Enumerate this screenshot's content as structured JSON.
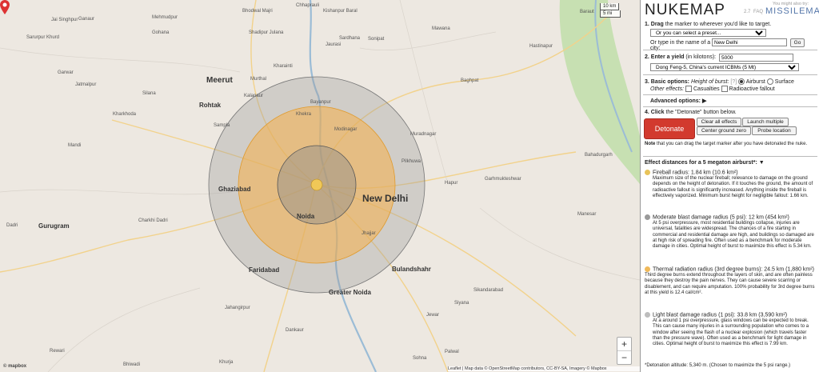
{
  "app": {
    "title": "NUKEMAP",
    "version": "2.7",
    "faq": "FAQ",
    "also_label": "You might also try:",
    "also_link": "MISSILEMAP"
  },
  "step1": {
    "label_bold": "1. Drag",
    "label_rest": "the marker to wherever you'd like to target.",
    "preset_value": "Or you can select a preset...",
    "city_label": "Or type in the name of a city:",
    "city_value": "New Delhi",
    "go": "Go"
  },
  "step2": {
    "label": "2. Enter a yield",
    "label_unit": "(in kilotons):",
    "yield_value": "5000",
    "preset_value": "Dong Feng-5, China's current ICBMs (5 Mt)"
  },
  "step3": {
    "label": "3. Basic options:",
    "height_label": "Height of burst:",
    "help": "[?]",
    "airburst": "Airburst",
    "surface": "Surface",
    "other_label": "Other effects:",
    "casualties": "Casualties",
    "fallout": "Radioactive fallout",
    "advanced": "Advanced options: ▶"
  },
  "step4": {
    "label": "4. Click",
    "label_rest": "the \"Detonate\" button below.",
    "detonate": "Detonate",
    "clear": "Clear all effects",
    "launch": "Launch multiple",
    "center": "Center ground zero",
    "probe": "Probe location",
    "note_bold": "Note",
    "note_rest": "that you can drag the target marker after you have detonated the nuke."
  },
  "effects": {
    "heading": "Effect distances for a 5 megaton airburst*: ▼",
    "items": [
      {
        "title": "Fireball radius: 1.84 km (10.6 km²)",
        "color": "#e8c35a",
        "desc": "Maximum size of the nuclear fireball; relevance to damage on the ground depends on the height of detonation. If it touches the ground, the amount of radioactive fallout is significantly increased. Anything inside the fireball is effectively vaporized. Minimum burst height for negligible fallout: 1.66 km."
      },
      {
        "title": "Moderate blast damage radius (5 psi): 12 km (454 km²)",
        "color": "#9a9a9a",
        "desc": "At 5 psi overpressure, most residential buildings collapse, injuries are universal, fatalities are widespread. The chances of a fire starting in commercial and residential damage are high, and buildings so damaged are at high risk of spreading fire. Often used as a benchmark for moderate damage in cities. Optimal height of burst to maximize this effect is 5.34 km."
      },
      {
        "title": "Thermal radiation radius (3rd degree burns): 24.5 km (1,880 km²)",
        "color": "#f0b95a",
        "desc": "Third degree burns extend throughout the layers of skin, and are often painless because they destroy the pain nerves. They can cause severe scarring or disablement, and can require amputation. 100% probability for 3rd degree burns at this yield is 12.4 cal/cm²."
      },
      {
        "title": "Light blast damage radius (1 psi): 33.8 km (3,590 km²)",
        "color": "#bdbdbd",
        "desc": "At a around 1 psi overpressure, glass windows can be expected to break. This can cause many injuries in a surrounding population who comes to a window after seeing the flash of a nuclear explosion (which travels faster than the pressure wave). Often used as a benchmark for light damage in cities. Optimal height of burst to maximize this effect is 7.99 km."
      }
    ],
    "footnote": "*Detonation altitude: 5,340 m. (Chosen to maximize the 5 psi range.)"
  },
  "map": {
    "scale_km": "10 km",
    "scale_mi": "5 mi",
    "zoom_in": "+",
    "zoom_out": "−",
    "attribution": "Leaflet | Map data © OpenStreetMap contributors, CC-BY-SA, Imagery © Mapbox",
    "mapbox": "© mapbox",
    "places": [
      {
        "name": "Chhaprauli",
        "cls": ""
      },
      {
        "name": "Kishanpur Baral",
        "cls": ""
      },
      {
        "name": "Bhodwal Majri",
        "cls": ""
      },
      {
        "name": "Mehmudpur",
        "cls": ""
      },
      {
        "name": "Jai Singhpur",
        "cls": ""
      },
      {
        "name": "Ganaur",
        "cls": ""
      },
      {
        "name": "Shadipur Julana",
        "cls": ""
      },
      {
        "name": "Gohana",
        "cls": ""
      },
      {
        "name": "Sarurpur Khurd",
        "cls": ""
      },
      {
        "name": "Sardhana",
        "cls": ""
      },
      {
        "name": "Mawana",
        "cls": ""
      },
      {
        "name": "Hastinapur",
        "cls": ""
      },
      {
        "name": "Baraut",
        "cls": ""
      },
      {
        "name": "Jaurasi",
        "cls": ""
      },
      {
        "name": "Sonipat",
        "cls": ""
      },
      {
        "name": "Murthal",
        "cls": ""
      },
      {
        "name": "Kharainti",
        "cls": ""
      },
      {
        "name": "Garwar",
        "cls": ""
      },
      {
        "name": "Jatmalpur",
        "cls": ""
      },
      {
        "name": "Meerut",
        "cls": "big"
      },
      {
        "name": "Baghpat",
        "cls": ""
      },
      {
        "name": "Bayanpur",
        "cls": ""
      },
      {
        "name": "Kalanaur",
        "cls": ""
      },
      {
        "name": "Silana",
        "cls": ""
      },
      {
        "name": "Rohtak",
        "cls": "med"
      },
      {
        "name": "Kharkhoda",
        "cls": ""
      },
      {
        "name": "Sampla",
        "cls": ""
      },
      {
        "name": "Mandi",
        "cls": ""
      },
      {
        "name": "Khekra",
        "cls": ""
      },
      {
        "name": "Modinagar",
        "cls": ""
      },
      {
        "name": "Muradnagar",
        "cls": ""
      },
      {
        "name": "Pilkhuwa",
        "cls": ""
      },
      {
        "name": "Hapur",
        "cls": ""
      },
      {
        "name": "Garhmukteshwar",
        "cls": ""
      },
      {
        "name": "Bahadurgarh",
        "cls": ""
      },
      {
        "name": "Ghaziabad",
        "cls": "med"
      },
      {
        "name": "New Delhi",
        "cls": "center"
      },
      {
        "name": "Noida",
        "cls": "med"
      },
      {
        "name": "Jhajjar",
        "cls": ""
      },
      {
        "name": "Charkhi Dadri",
        "cls": ""
      },
      {
        "name": "Dadri",
        "cls": ""
      },
      {
        "name": "Gurugram",
        "cls": "med"
      },
      {
        "name": "Faridabad",
        "cls": "med"
      },
      {
        "name": "Greater Noida",
        "cls": "med"
      },
      {
        "name": "Bulandshahr",
        "cls": "med"
      },
      {
        "name": "Sikandarabad",
        "cls": ""
      },
      {
        "name": "Siyana",
        "cls": ""
      },
      {
        "name": "Manesar",
        "cls": ""
      },
      {
        "name": "Jahangirpur",
        "cls": ""
      },
      {
        "name": "Rewari",
        "cls": ""
      },
      {
        "name": "Bhiwadi",
        "cls": ""
      },
      {
        "name": "Khurja",
        "cls": ""
      },
      {
        "name": "Jewar",
        "cls": ""
      },
      {
        "name": "Palwal",
        "cls": ""
      },
      {
        "name": "Sohna",
        "cls": ""
      },
      {
        "name": "Dankaur",
        "cls": ""
      }
    ]
  }
}
